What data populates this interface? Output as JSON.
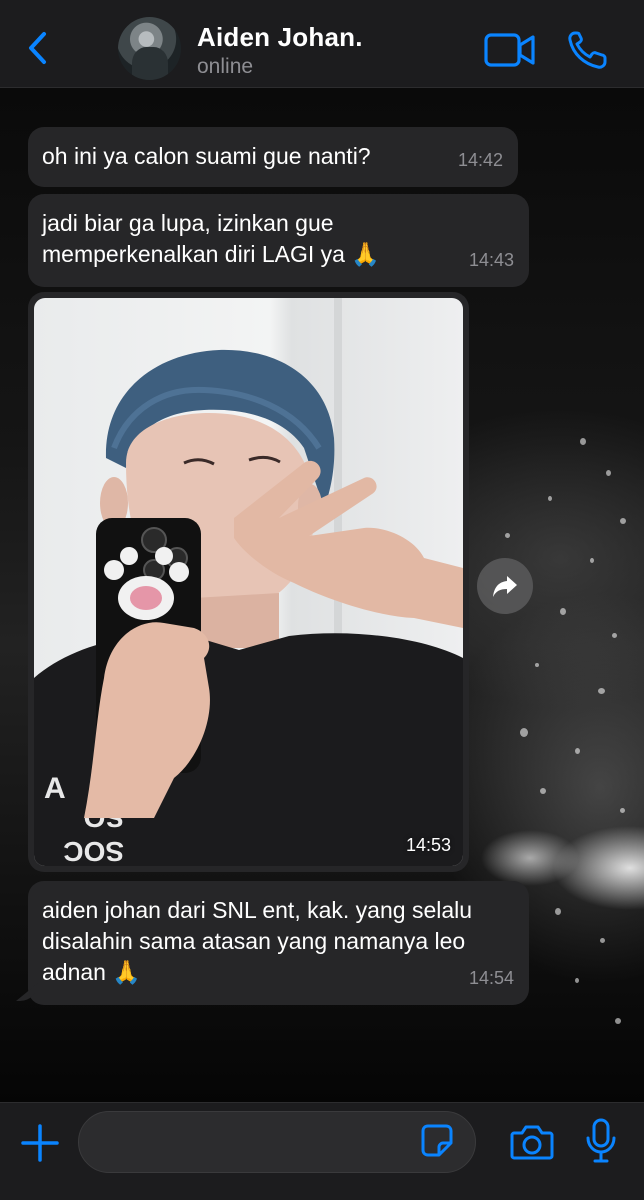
{
  "header": {
    "back_icon": "chevron-left-icon",
    "contact_name": "Aiden Johan.",
    "status": "online",
    "video_icon": "video-camera-icon",
    "call_icon": "phone-icon",
    "accent_color": "#0a84ff"
  },
  "messages": [
    {
      "text": "oh ini ya calon suami gue nanti?",
      "time": "14:42"
    },
    {
      "text": "jadi biar ga lupa, izinkan gue memperkenalkan diri LAGI ya 🙏",
      "time": "14:43"
    },
    {
      "type": "image",
      "time": "14:53"
    },
    {
      "text": "aiden johan dari SNL ent, kak. yang selalu disalahin sama atasan yang namanya leo adnan 🙏",
      "time": "14:54"
    }
  ],
  "forward_icon": "forward-arrow-icon",
  "input_bar": {
    "plus_icon": "plus-icon",
    "message_value": "",
    "sticker_icon": "sticker-icon",
    "camera_icon": "camera-icon",
    "mic_icon": "microphone-icon"
  },
  "colors": {
    "bubble": "#262628",
    "bar": "#1c1c1e",
    "timestamp": "#8e8e93"
  }
}
